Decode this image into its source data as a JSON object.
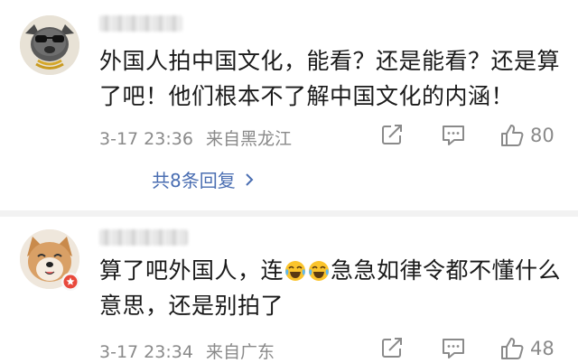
{
  "comments": [
    {
      "text": "外国人拍中国文化，能看？还是能看？还是算了吧！他们根本不了解中国文化的内涵！",
      "date": "3-17 23:36",
      "location": "来自黑龙江",
      "likes": "80",
      "replies_label": "共8条回复"
    },
    {
      "text_before": "算了吧外国人，连",
      "text_after": "急急如律令都不懂什么意思，还是别拍了",
      "emoji": "laugh-cry-icon",
      "date": "3-17 23:34",
      "location": "来自广东",
      "likes": "48"
    }
  ],
  "colors": {
    "text": "#1a1a1a",
    "meta": "#8a8a8a",
    "link": "#4a6eb2",
    "separator": "#f2f2f2"
  }
}
